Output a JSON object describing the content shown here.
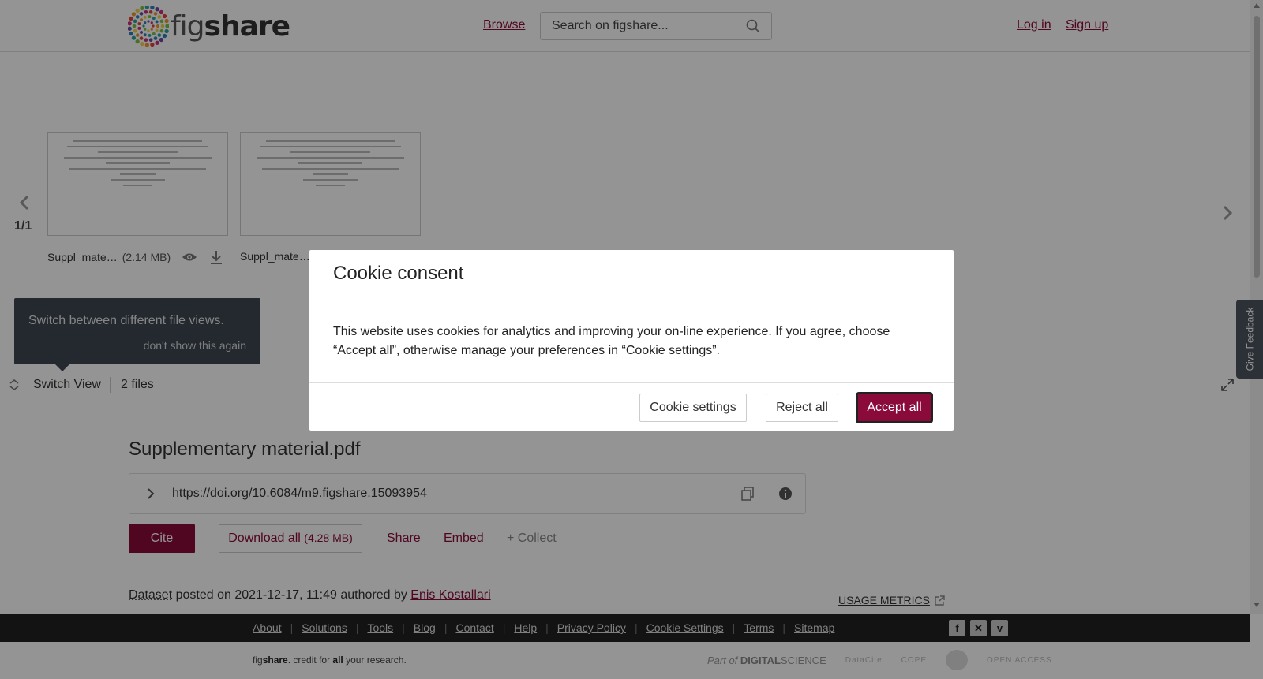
{
  "header": {
    "logo_prefix": "fig",
    "logo_suffix": "share",
    "browse_label": "Browse",
    "search_placeholder": "Search on figshare...",
    "login_label": "Log in",
    "signup_label": "Sign up"
  },
  "viewer": {
    "page_count": "1/1",
    "files": [
      {
        "name": "Suppl_mate…",
        "size": "(2.14 MB)"
      },
      {
        "name": "Suppl_mate…",
        "size": ""
      }
    ],
    "tooltip_text": "Switch between different file views.",
    "tooltip_dismiss": "don't show this again",
    "switch_view_label": "Switch View",
    "files_count": "2 files"
  },
  "item": {
    "title": "Supplementary material.pdf",
    "doi": "https://doi.org/10.6084/m9.figshare.15093954",
    "cite_label": "Cite",
    "download_label": "Download all",
    "download_size": "(4.28 MB)",
    "share_label": "Share",
    "embed_label": "Embed",
    "collect_label": "+ Collect",
    "item_type": "Dataset",
    "posted_text": " posted on 2021-12-17, 11:49 authored by ",
    "author": "Enis Kostallari",
    "usage_label": "USAGE METRICS"
  },
  "footer": {
    "links": [
      "About",
      "Solutions",
      "Tools",
      "Blog",
      "Contact",
      "Help",
      "Privacy Policy",
      "Cookie Settings",
      "Terms",
      "Sitemap"
    ],
    "tagline_fig": "fig",
    "tagline_share": "share",
    "tagline_mid": ". credit for ",
    "tagline_all": "all",
    "tagline_end": " your research.",
    "part_of": "Part of",
    "ds_name_bold": "DIGITAL",
    "ds_name": "SCIENCE",
    "partner_datacite": "DataCite",
    "partner_cope": "COPE",
    "partner_oa": "OPEN ACCESS",
    "social_vimeo": "v"
  },
  "feedback_label": "Give Feedback",
  "cookie": {
    "title": "Cookie consent",
    "body": "This website uses cookies for analytics and improving your on-line experience. If you agree, choose “Accept all”, otherwise manage your preferences in “Cookie settings”.",
    "settings_label": "Cookie settings",
    "reject_label": "Reject all",
    "accept_label": "Accept all"
  },
  "colors": {
    "brand": "#8a0a3a",
    "footer_bg": "#222222",
    "tooltip_bg": "#3e4852"
  }
}
